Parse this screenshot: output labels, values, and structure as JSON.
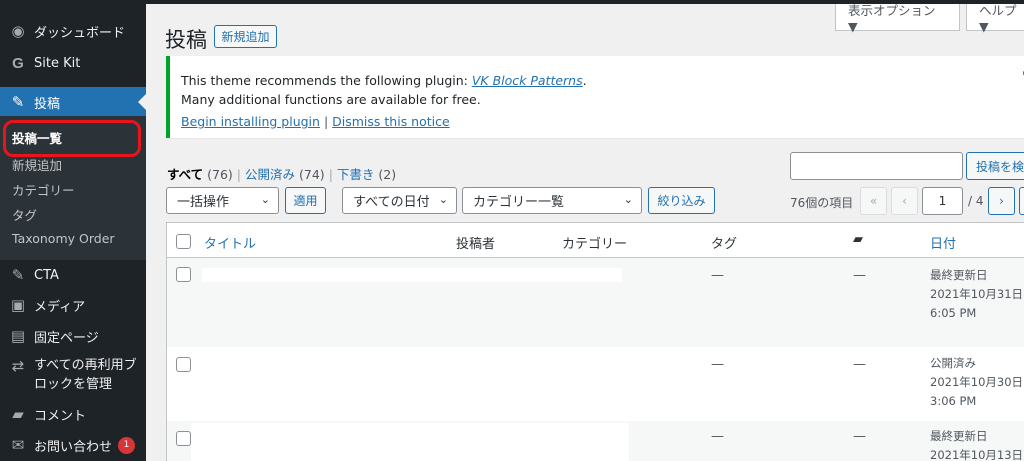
{
  "sidebar": {
    "items": [
      {
        "label": "ダッシュボード",
        "icon": "dashboard-icon"
      },
      {
        "label": "Site Kit",
        "icon": "google-g-icon"
      },
      {
        "label": "投稿",
        "icon": "pushpin-icon",
        "active": true
      },
      {
        "label": "CTA",
        "icon": "pushpin-icon"
      },
      {
        "label": "メディア",
        "icon": "media-icon"
      },
      {
        "label": "固定ページ",
        "icon": "page-icon"
      },
      {
        "label": "すべての再利用ブ",
        "label2": "ロックを管理",
        "icon": "reusable-icon"
      },
      {
        "label": "コメント",
        "icon": "comment-icon"
      },
      {
        "label": "お問い合わせ",
        "icon": "mail-icon",
        "badge": "1"
      }
    ],
    "submenu": [
      "投稿一覧",
      "新規追加",
      "カテゴリー",
      "タグ",
      "Taxonomy Order"
    ]
  },
  "screen_tabs": {
    "options": "表示オプション ▼",
    "help": "ヘルプ ▼"
  },
  "header": {
    "title": "投稿",
    "add_new": "新規追加"
  },
  "notice": {
    "line1_prefix": "This theme recommends the following plugin: ",
    "plugin_link": "VK Block Patterns",
    "line1_suffix": ".",
    "line2": "Many additional functions are available for free.",
    "install_link": "Begin installing plugin",
    "sep": "|",
    "dismiss_link": "Dismiss this notice"
  },
  "views": {
    "all": "すべて",
    "all_count": "(76)",
    "published": "公開済み",
    "published_count": "(74)",
    "drafts": "下書き",
    "drafts_count": "(2)"
  },
  "search": {
    "button": "投稿を検"
  },
  "filters": {
    "bulk": "一括操作",
    "apply": "適用",
    "dates": "すべての日付",
    "categories": "カテゴリー一覧",
    "filter": "絞り込み"
  },
  "pagination": {
    "items": "76個の項目",
    "first": "«",
    "prev": "‹",
    "current": "1",
    "total": "/ 4",
    "next": "›"
  },
  "table": {
    "headers": {
      "title": "タイトル",
      "author": "投稿者",
      "categories": "カテゴリー",
      "tags": "タグ",
      "date": "日付"
    },
    "rows": [
      {
        "tags": "—",
        "comments": "—",
        "status": "最終更新日",
        "date": "2021年10月31日",
        "time": "6:05 PM"
      },
      {
        "tags": "—",
        "comments": "—",
        "status": "公開済み",
        "date": "2021年10月30日",
        "time": "3:06 PM"
      },
      {
        "tags": "—",
        "comments": "—",
        "status": "最終更新日",
        "date": "2021年10月13日",
        "time": ""
      }
    ]
  },
  "colors": {
    "accent": "#2271b1",
    "sidebar": "#1d2327",
    "notice_success": "#00a32a",
    "highlight": "#e8161c"
  }
}
